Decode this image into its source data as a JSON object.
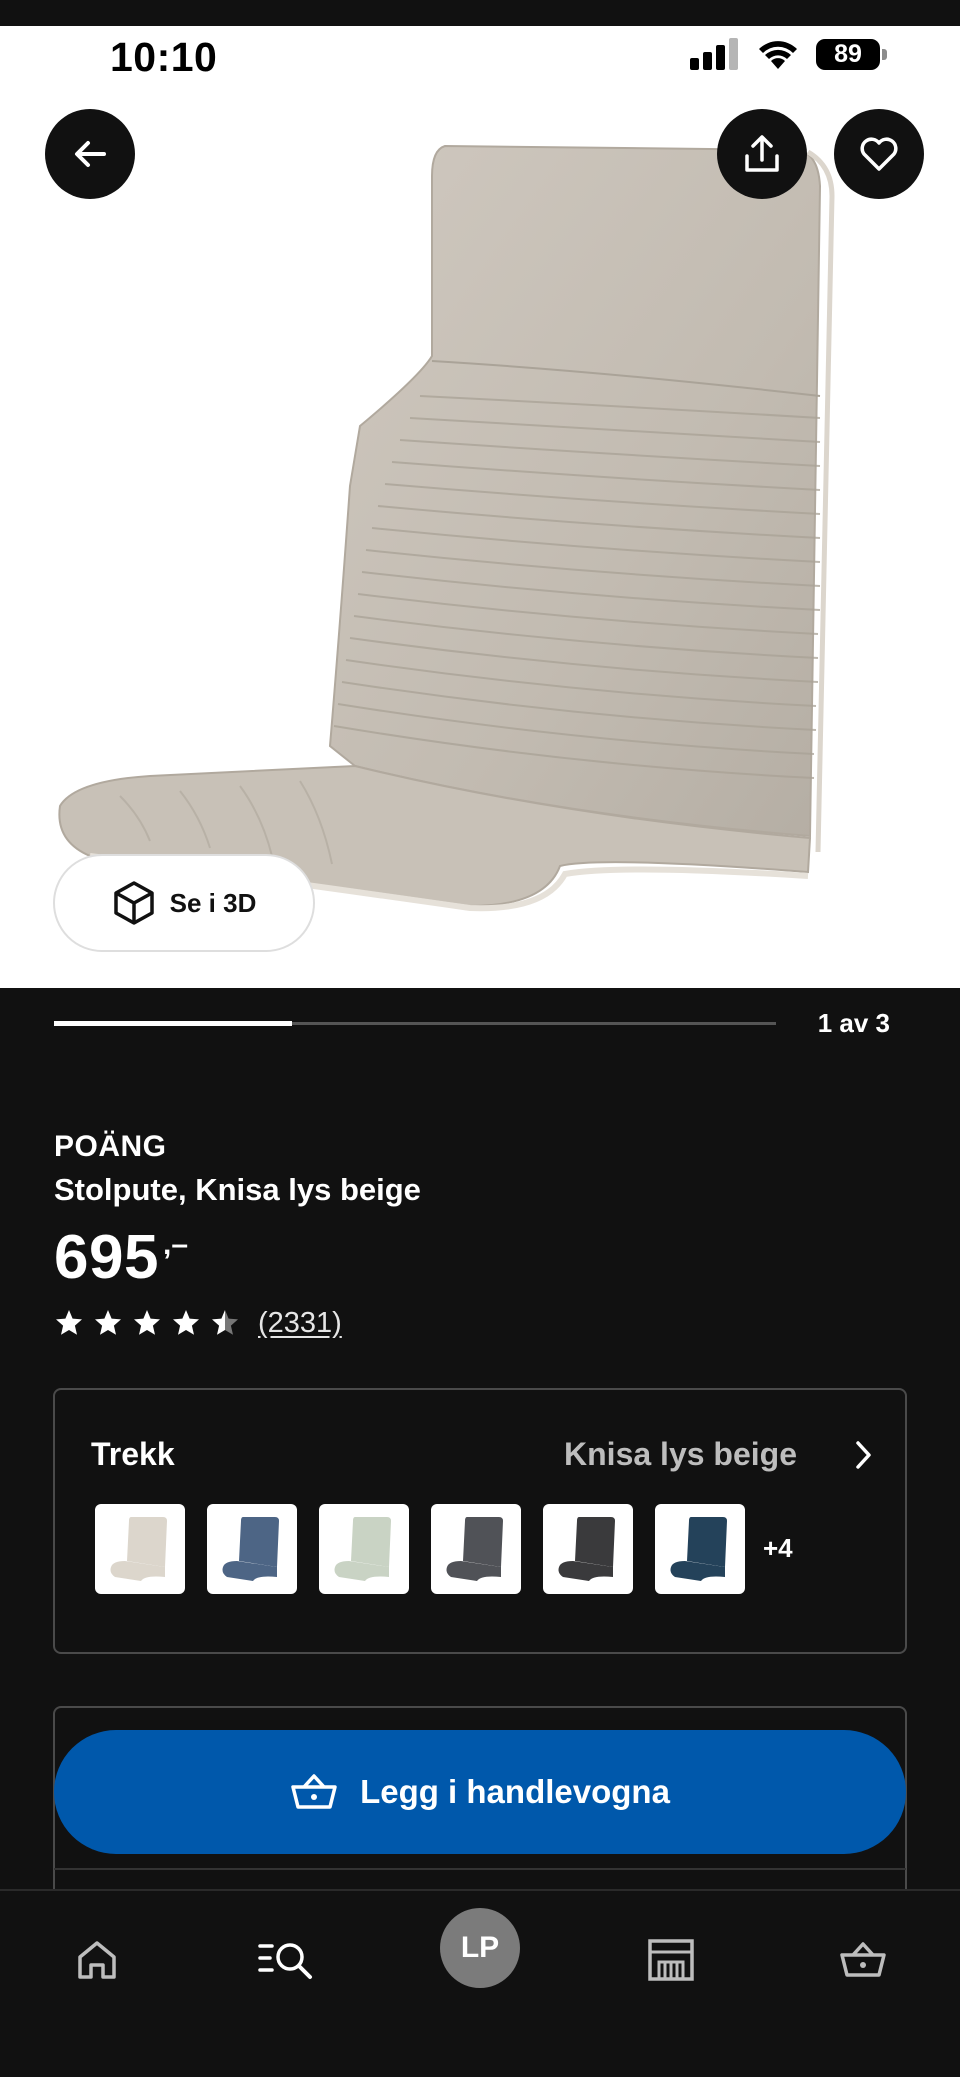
{
  "status_bar": {
    "time": "10:10",
    "battery": "89"
  },
  "hero": {
    "view_3d_label": "Se i 3D",
    "gallery_progress": 0.33,
    "page_counter": "1 av 3"
  },
  "product": {
    "brand": "POÄNG",
    "description": "Stolpute, Knisa lys beige",
    "price": "695",
    "price_suffix": ",–",
    "rating": 4.5,
    "review_count": "(2331)"
  },
  "variant": {
    "title": "Trekk",
    "selected": "Knisa lys beige",
    "swatches": [
      {
        "color": "#dcd6cc"
      },
      {
        "color": "#4d6585"
      },
      {
        "color": "#c9d3c4"
      },
      {
        "color": "#505257"
      },
      {
        "color": "#3a3a3c"
      },
      {
        "color": "#24425a"
      }
    ],
    "more": "+4"
  },
  "cart": {
    "label": "Legg i handlevogna"
  },
  "tabbar": {
    "items": [
      {
        "icon": "home-icon"
      },
      {
        "icon": "search-list-icon"
      },
      {
        "icon": "avatar",
        "initials": "LP"
      },
      {
        "icon": "store-icon"
      },
      {
        "icon": "basket-icon"
      }
    ]
  },
  "colors": {
    "accent_blue": "#0058ab",
    "background": "#111111",
    "cushion": "#c9c2b8"
  }
}
